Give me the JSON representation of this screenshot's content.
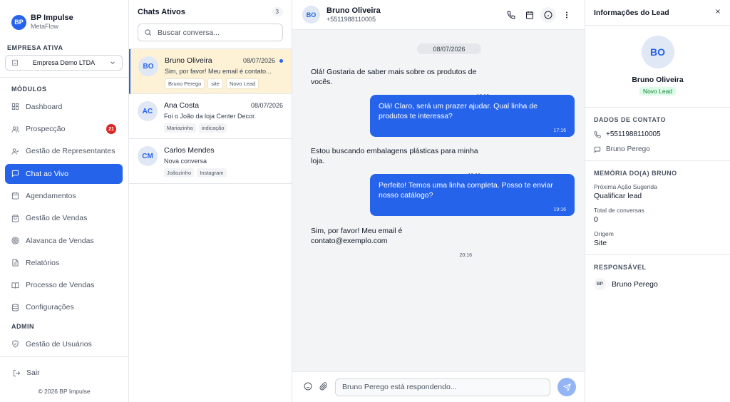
{
  "brand": {
    "initials": "BP",
    "name": "BP Impulse",
    "subtitle": "MetaFlow"
  },
  "company": {
    "section_label": "EMPRESA ATIVA",
    "selected": "Empresa Demo LTDA"
  },
  "nav": {
    "modules_label": "MÓDULOS",
    "items": [
      {
        "label": "Dashboard",
        "icon": "grid-icon"
      },
      {
        "label": "Prospecção",
        "icon": "users-icon",
        "badge": "21"
      },
      {
        "label": "Gestão de Representantes",
        "icon": "user-check-icon"
      },
      {
        "label": "Chat ao Vivo",
        "icon": "message-icon",
        "active": true
      },
      {
        "label": "Agendamentos",
        "icon": "calendar-icon"
      },
      {
        "label": "Gestão de Vendas",
        "icon": "shopping-bag-icon"
      },
      {
        "label": "Alavanca de Vendas",
        "icon": "target-icon"
      },
      {
        "label": "Relatórios",
        "icon": "file-icon"
      },
      {
        "label": "Processo de Vendas",
        "icon": "book-icon"
      },
      {
        "label": "Configurações",
        "icon": "database-icon"
      }
    ],
    "admin_label": "ADMIN",
    "admin_items": [
      {
        "label": "Gestão de Usuários",
        "icon": "shield-icon"
      }
    ],
    "logout_label": "Sair",
    "copyright": "© 2026 BP Impulse"
  },
  "chatlist": {
    "title": "Chats Ativos",
    "count": "3",
    "search_placeholder": "Buscar conversa...",
    "items": [
      {
        "initials": "BO",
        "name": "Bruno Oliveira",
        "date": "08/07/2026",
        "preview": "Sim, por favor! Meu email é contato...",
        "tags": [
          "Bruno Perego",
          "site",
          "Novo Lead"
        ],
        "unread": true
      },
      {
        "initials": "AC",
        "name": "Ana Costa",
        "date": "08/07/2026",
        "preview": "Foi o João da loja Center Decor.",
        "tags": [
          "Mariazinha",
          "indicação"
        ]
      },
      {
        "initials": "CM",
        "name": "Carlos Mendes",
        "date": "",
        "preview": "Nova conversa",
        "tags": [
          "Joãozinho",
          "Instagram"
        ]
      }
    ]
  },
  "conversation": {
    "initials": "BO",
    "name": "Bruno Oliveira",
    "phone": "+5511988110005",
    "date_divider": "08/07/2026",
    "messages": [
      {
        "dir": "in",
        "text": "Olá! Gostaria de saber mais sobre os produtos de vocês.",
        "time": "16:16"
      },
      {
        "dir": "out",
        "text": "Olá! Claro, será um prazer ajudar. Qual linha de produtos te interessa?",
        "time": "17:16"
      },
      {
        "dir": "in",
        "text": "Estou buscando embalagens plásticas para minha loja.",
        "time": "18:16"
      },
      {
        "dir": "out",
        "text": "Perfeito! Temos uma linha completa. Posso te enviar nosso catálogo?",
        "time": "19:16"
      },
      {
        "dir": "in",
        "text": "Sim, por favor! Meu email é contato@exemplo.com",
        "time": "20:16"
      }
    ],
    "composer_placeholder": "Bruno Perego está respondendo..."
  },
  "lead": {
    "title": "Informações do Lead",
    "initials": "BO",
    "name": "Bruno Oliveira",
    "status": "Novo Lead",
    "contact_title": "DADOS DE CONTATO",
    "phone": "+5511988110005",
    "owner_contact": "Bruno Perego",
    "memory_title": "MEMÓRIA DO(A) BRUNO",
    "next_action_label": "Próxima Ação Sugerida",
    "next_action_value": "Qualificar lead",
    "total_label": "Total de conversas",
    "total_value": "0",
    "origin_label": "Origem",
    "origin_value": "Site",
    "responsible_title": "RESPONSÁVEL",
    "responsible_initials": "BP",
    "responsible_name": "Bruno Perego"
  },
  "colors": {
    "accent": "#2563eb",
    "badge": "#dc2626",
    "selected_row": "#fdf2d6"
  }
}
